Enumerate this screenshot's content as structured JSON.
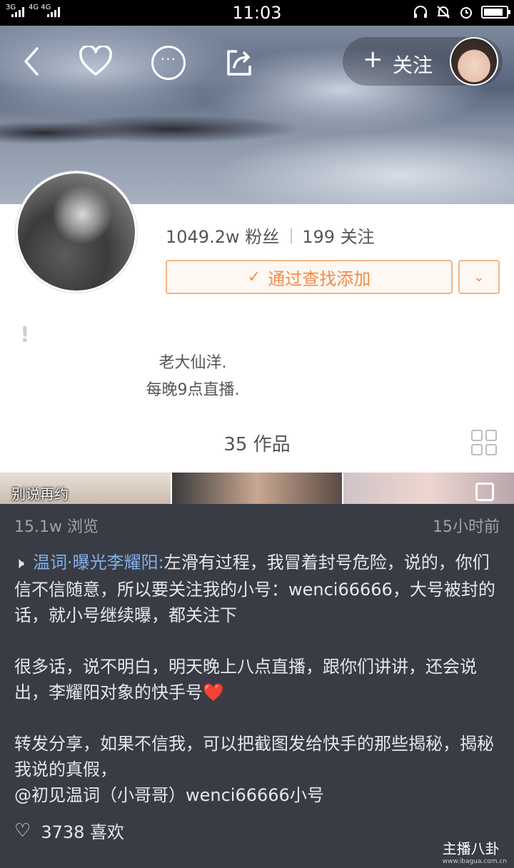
{
  "status_bar": {
    "time": "11:03",
    "signal_1": "3G",
    "signal_2": "4G 4G"
  },
  "header": {
    "follow_label": "关注"
  },
  "profile": {
    "followers": "1049.2w 粉丝",
    "following": "199 关注",
    "find_button": "通过查找添加",
    "bio_line_1": "老大仙洋.",
    "bio_line_2": "每晚9点直播.",
    "works": "35 作品"
  },
  "thumbs": {
    "caption_1": "别说再约"
  },
  "post": {
    "views": "15.1w 浏览",
    "time_ago": "15小时前",
    "author": "温词·曝光李耀阳:",
    "para_1": "左滑有过程，我冒着封号危险，说的，你们信不信随意，所以要关注我的小号：wenci66666，大号被封的话，就小号继续曝，都关注下",
    "para_2": "很多话，说不明白，明天晚上八点直播，跟你们讲讲，还会说出，李耀阳对象的快手号",
    "para_2_emoji": "❤️",
    "para_3": "转发分享，如果不信我，可以把截图发给快手的那些揭秘，揭秘我说的真假，",
    "para_4": " @初见温词（小哥哥）wenci66666小号",
    "likes": "3738 喜欢"
  },
  "watermark": {
    "text": "主播八卦",
    "url": "www.ibagua.com.cn"
  },
  "colors": {
    "accent_orange": "#ef8c4c",
    "link_blue": "#7fb0ec",
    "overlay_bg": "#393c44"
  }
}
